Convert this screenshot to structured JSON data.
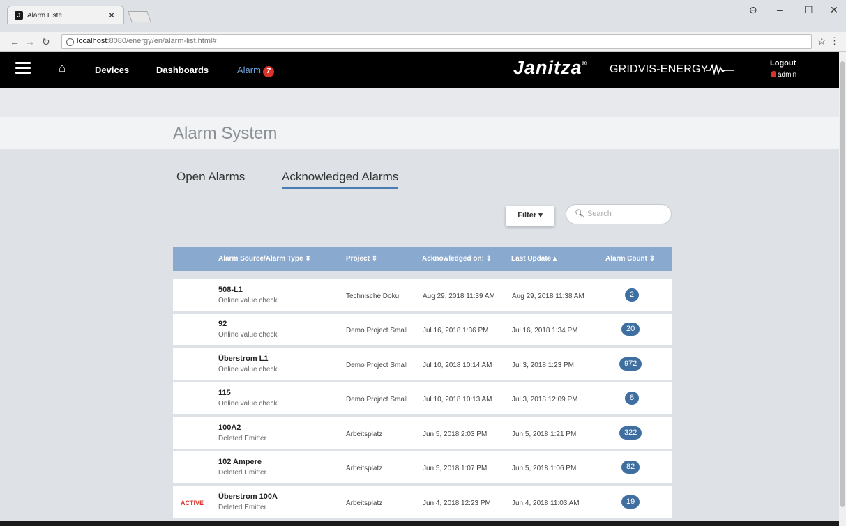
{
  "browser": {
    "tab_title": "Alarm Liste",
    "favicon": "J",
    "url_host": "localhost",
    "url_path": ":8080/energy/en/alarm-list.html#"
  },
  "header": {
    "nav": {
      "devices": "Devices",
      "dashboards": "Dashboards",
      "alarm": "Alarm",
      "alarm_count": "7"
    },
    "brand": "Janitza",
    "brand_mark": "®",
    "brand_sub": "GRIDVIS-ENERGY",
    "logout": "Logout",
    "user": "admin"
  },
  "page": {
    "title": "Alarm System",
    "tabs": [
      "Open Alarms",
      "Acknowledged Alarms"
    ],
    "filter_label": "Filter",
    "search_placeholder": "Search"
  },
  "table": {
    "columns": [
      "Alarm Source/Alarm Type",
      "Project",
      "Acknowledged on:",
      "Last Update",
      "Alarm Count"
    ],
    "sort_asc_column": "Last Update",
    "rows": [
      {
        "status": "",
        "source": "508-L1",
        "type": "Online value check",
        "project": "Technische Doku",
        "acknowledged": "Aug 29, 2018 11:39 AM",
        "last_update": "Aug 29, 2018 11:38 AM",
        "count": "2"
      },
      {
        "status": "",
        "source": "92",
        "type": "Online value check",
        "project": "Demo Project Small",
        "acknowledged": "Jul 16, 2018 1:36 PM",
        "last_update": "Jul 16, 2018 1:34 PM",
        "count": "20"
      },
      {
        "status": "",
        "source": "Überstrom L1",
        "type": "Online value check",
        "project": "Demo Project Small",
        "acknowledged": "Jul 10, 2018 10:14 AM",
        "last_update": "Jul 3, 2018 1:23 PM",
        "count": "972"
      },
      {
        "status": "",
        "source": "115",
        "type": "Online value check",
        "project": "Demo Project Small",
        "acknowledged": "Jul 10, 2018 10:13 AM",
        "last_update": "Jul 3, 2018 12:09 PM",
        "count": "8"
      },
      {
        "status": "",
        "source": "100A2",
        "type": "Deleted Emitter",
        "project": "Arbeitsplatz",
        "acknowledged": "Jun 5, 2018 2:03 PM",
        "last_update": "Jun 5, 2018 1:21 PM",
        "count": "322"
      },
      {
        "status": "",
        "source": "102 Ampere",
        "type": "Deleted Emitter",
        "project": "Arbeitsplatz",
        "acknowledged": "Jun 5, 2018 1:07 PM",
        "last_update": "Jun 5, 2018 1:06 PM",
        "count": "82"
      },
      {
        "status": "ACTIVE",
        "source": "Überstrom 100A",
        "type": "Deleted Emitter",
        "project": "Arbeitsplatz",
        "acknowledged": "Jun 4, 2018 12:23 PM",
        "last_update": "Jun 4, 2018 11:03 AM",
        "count": "19"
      }
    ]
  },
  "colors": {
    "header_bg": "#000000",
    "accent": "#4a7db1",
    "table_header": "#8aa9cf",
    "badge": "#3f6ea0",
    "alert": "#d9342b"
  },
  "icons": [
    "profile-icon",
    "minimize-icon",
    "maximize-icon",
    "close-icon",
    "back-icon",
    "forward-icon",
    "reload-icon",
    "info-icon",
    "bookmark-star-icon",
    "menu-kebab-icon",
    "hamburger-icon",
    "home-icon",
    "user-icon",
    "search-icon",
    "caret-down-icon",
    "sort-icon"
  ]
}
